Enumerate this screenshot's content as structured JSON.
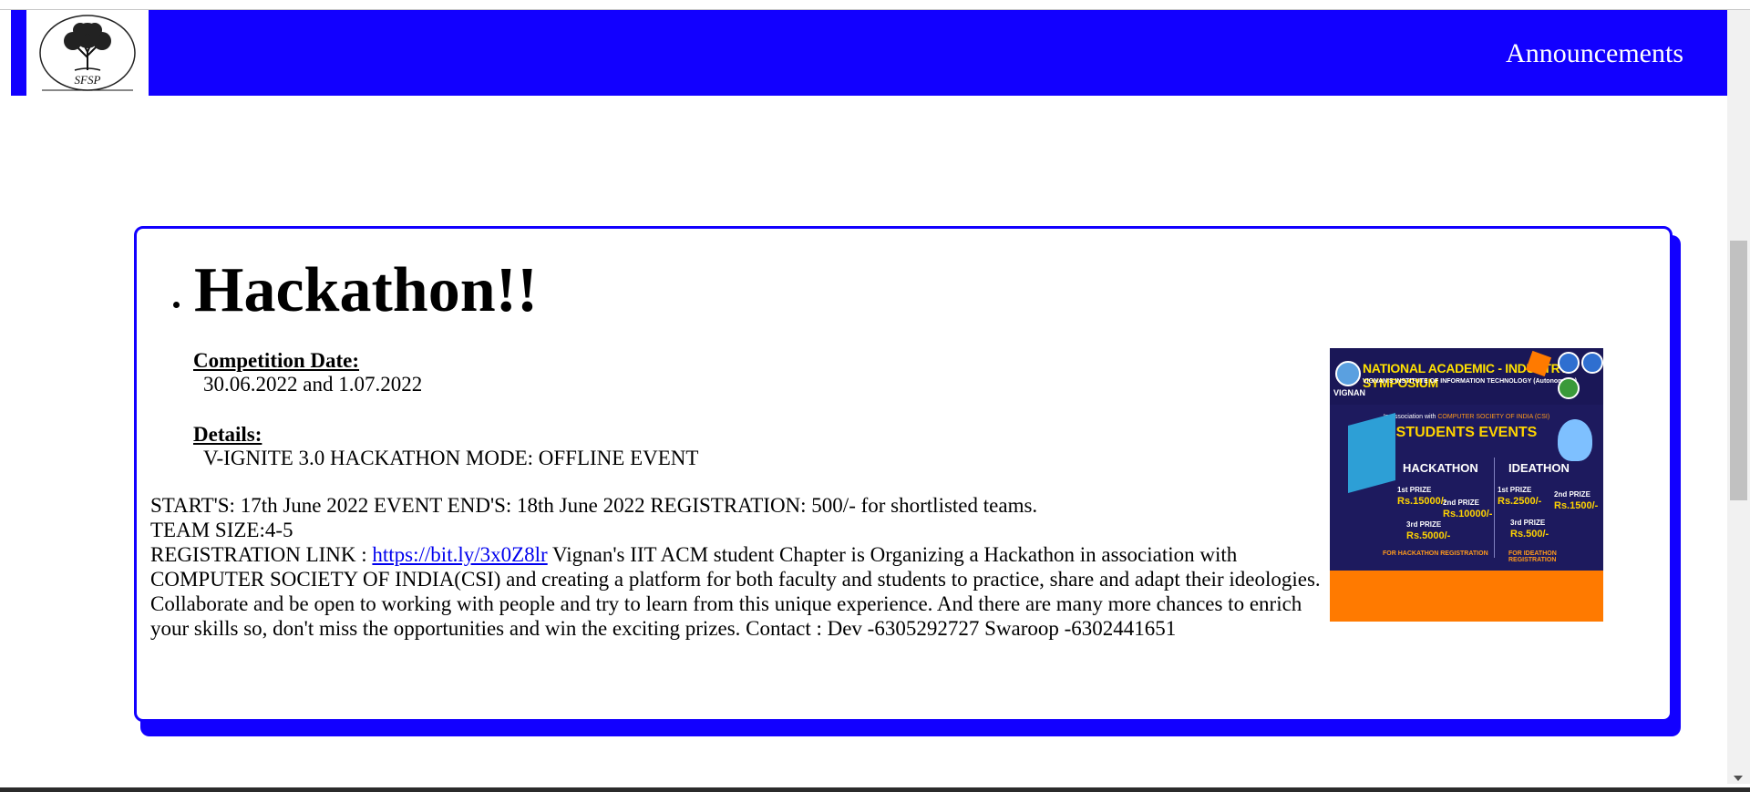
{
  "header": {
    "logo_text": "SFSP",
    "nav_announcements": "Announcements"
  },
  "colors": {
    "brand_blue": "#1200ff",
    "link_blue": "#0000ee"
  },
  "card": {
    "title": "Hackathon!!",
    "competition_date_label": "Competition Date:",
    "competition_date_value": "30.06.2022 and 1.07.2022",
    "details_label": "Details:",
    "details_value": "V-IGNITE 3.0 HACKATHON MODE: OFFLINE EVENT",
    "line1": "START'S: 17th June 2022 EVENT END'S: 18th June 2022 REGISTRATION: 500/- for shortlisted teams.",
    "line2": "TEAM SIZE:4-5",
    "reg_prefix": "REGISTRATION LINK : ",
    "reg_link": "https://bit.ly/3x0Z8lr",
    "reg_suffix": " Vignan's IIT ACM student Chapter is Organizing a Hackathon in association with COMPUTER SOCIETY OF INDIA(CSI) and creating a platform for both faculty and students to practice, share and adapt their ideologies. Collaborate and be open to working with people and try to learn from this unique experience. And there are many more chances to enrich your skills so, don't miss the opportunities and win the exciting prizes. Contact : Dev -6305292727 Swaroop -6302441651"
  },
  "poster": {
    "vignan": "VIGNAN",
    "heading": "NATIONAL ACADEMIC - INDUSTRY SYMPOSIUM",
    "subheading": "VIGNAN'S INSTITUTE OF INFORMATION TECHNOLOGY (Autonomous)",
    "assoc_prefix": "In Association with ",
    "assoc_org": "COMPUTER SOCIETY OF INDIA (CSI)",
    "events_title": "STUDENTS EVENTS",
    "hackathon": "HACKATHON",
    "ideathon": "IDEATHON",
    "hack_prizes": [
      {
        "rank": "1st PRIZE",
        "amount": "Rs.15000/-"
      },
      {
        "rank": "2nd PRIZE",
        "amount": "Rs.10000/-"
      },
      {
        "rank": "3rd PRIZE",
        "amount": "Rs.5000/-"
      }
    ],
    "idea_prizes": [
      {
        "rank": "1st PRIZE",
        "amount": "Rs.2500/-"
      },
      {
        "rank": "2nd PRIZE",
        "amount": "Rs.1500/-"
      },
      {
        "rank": "3rd PRIZE",
        "amount": "Rs.500/-"
      }
    ],
    "hack_reg": "FOR HACKATHON REGISTRATION",
    "idea_reg": "FOR IDEATHON REGISTRATION"
  }
}
